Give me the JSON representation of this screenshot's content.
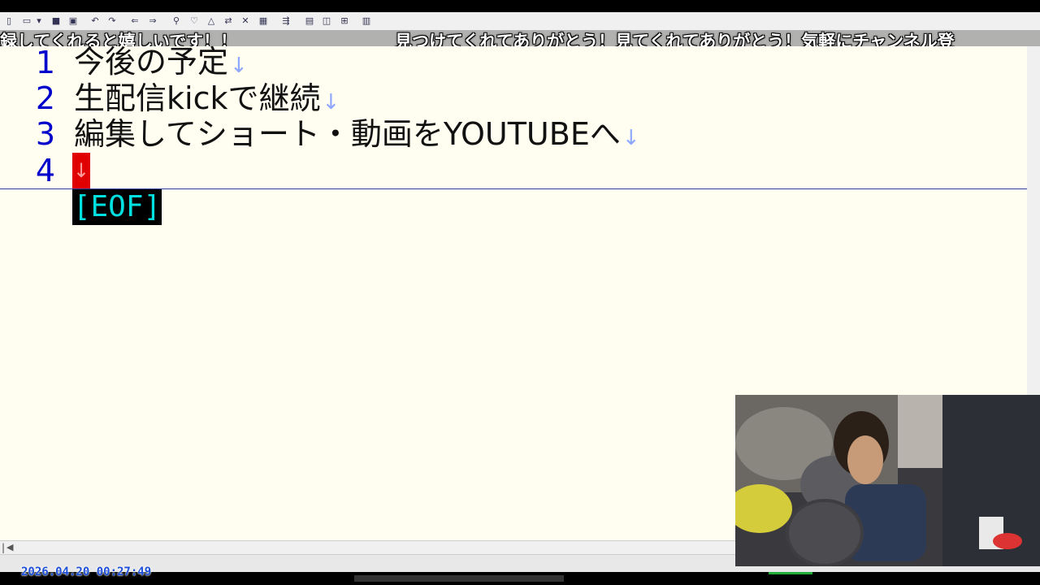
{
  "ticker": {
    "left_text": "録してくれると嬉しいです！！",
    "right_text": "見つけてくれてありがとう！見てくれてありがとう！気軽にチャンネル登"
  },
  "editor": {
    "lines": [
      {
        "number": "1",
        "text": "今後の予定",
        "eol": "↓"
      },
      {
        "number": "2",
        "text": "生配信kickで継続",
        "eol": "↓"
      },
      {
        "number": "3",
        "text": "編集してショート・動画をYOUTUBEへ",
        "eol": "↓"
      },
      {
        "number": "4",
        "text": "",
        "eol": "↓"
      }
    ],
    "eof_marker": "[EOF]"
  },
  "toolbar": {
    "icons": [
      "new-file-icon",
      "open-icon",
      "dropdown-icon",
      "save-icon",
      "save-all-icon",
      "undo-icon",
      "redo-icon",
      "back-icon",
      "forward-icon",
      "search-icon",
      "search-next-icon",
      "search-prev-icon",
      "replace-icon",
      "clear-icon",
      "grep-icon",
      "jump-icon",
      "outline-icon",
      "compare-icon",
      "tag-icon",
      "settings-icon"
    ]
  },
  "scrollbar": {
    "left_marker": "|"
  },
  "overlay": {
    "clock": "2026.04.20 00:27:49"
  },
  "colors": {
    "editor_bg": "#fffef0",
    "line_number": "#0000cc",
    "eol_mark": "#8fa8ff",
    "caret": "#e00000",
    "eof_text": "#00e0e0"
  }
}
